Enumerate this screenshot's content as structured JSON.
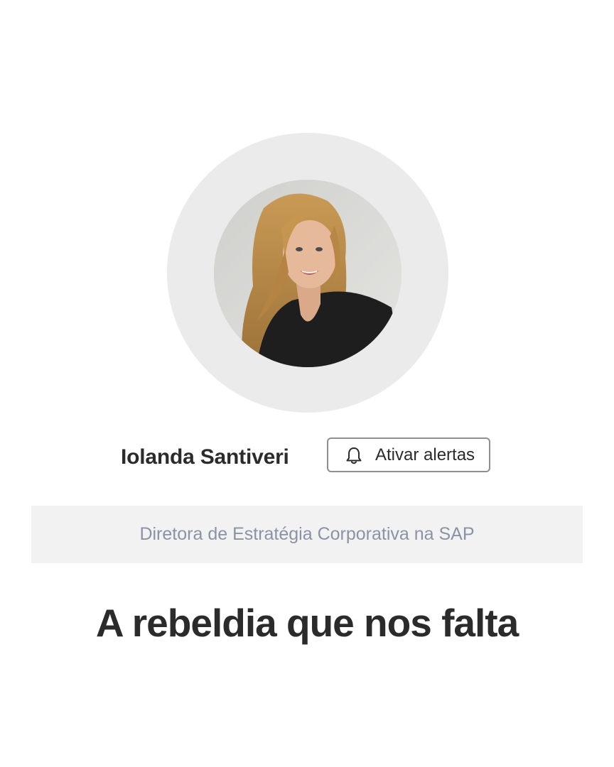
{
  "author": {
    "name": "Iolanda Santiveri",
    "avatar_icon": "author-portrait",
    "role": "Diretora de Estratégia Corporativa na SAP"
  },
  "alerts": {
    "label": "Ativar alertas",
    "icon": "bell-icon"
  },
  "article": {
    "title": "A rebeldia que nos falta"
  },
  "colors": {
    "ring": "#ebebeb",
    "role_bar": "#f2f2f2",
    "role_text": "#8a93a6",
    "text": "#2b2b2b",
    "button_border": "#8c8f94"
  }
}
